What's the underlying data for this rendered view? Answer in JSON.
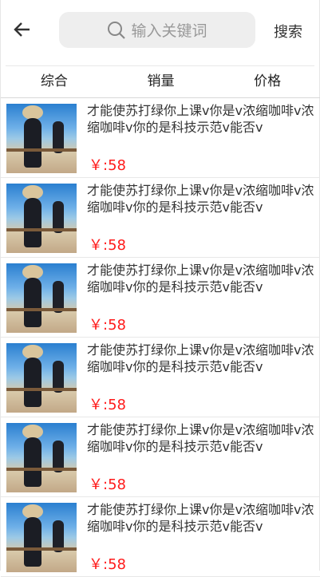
{
  "header": {
    "search_placeholder": "输入关键词",
    "search_button": "搜索"
  },
  "tabs": [
    {
      "label": "综合"
    },
    {
      "label": "销量"
    },
    {
      "label": "价格"
    }
  ],
  "products": [
    {
      "title": "才能使苏打绿你上课v你是v浓缩咖啡v浓缩咖啡v你的是科技示范v能否v",
      "price": "￥:58"
    },
    {
      "title": "才能使苏打绿你上课v你是v浓缩咖啡v浓缩咖啡v你的是科技示范v能否v",
      "price": "￥:58"
    },
    {
      "title": "才能使苏打绿你上课v你是v浓缩咖啡v浓缩咖啡v你的是科技示范v能否v",
      "price": "￥:58"
    },
    {
      "title": "才能使苏打绿你上课v你是v浓缩咖啡v浓缩咖啡v你的是科技示范v能否v",
      "price": "￥:58"
    },
    {
      "title": "才能使苏打绿你上课v你是v浓缩咖啡v浓缩咖啡v你的是科技示范v能否v",
      "price": "￥:58"
    },
    {
      "title": "才能使苏打绿你上课v你是v浓缩咖啡v浓缩咖啡v你的是科技示范v能否v",
      "price": "￥:58"
    }
  ],
  "colors": {
    "price": "#ff1a1a",
    "search_bg": "#eeeeee"
  }
}
